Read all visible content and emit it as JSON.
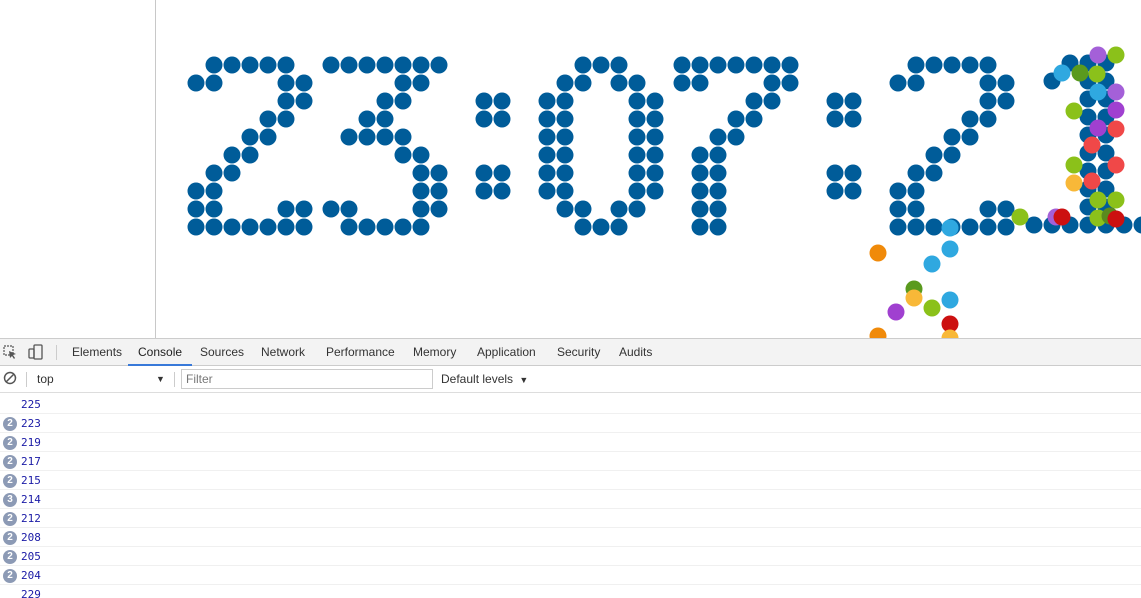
{
  "clock": {
    "time": "23:07:2",
    "color": "#005c99"
  },
  "devtools": {
    "tabs": [
      {
        "label": "Elements",
        "active": false
      },
      {
        "label": "Console",
        "active": true
      },
      {
        "label": "Sources",
        "active": false
      },
      {
        "label": "Network",
        "active": false
      },
      {
        "label": "Performance",
        "active": false
      },
      {
        "label": "Memory",
        "active": false
      },
      {
        "label": "Application",
        "active": false
      },
      {
        "label": "Security",
        "active": false
      },
      {
        "label": "Audits",
        "active": false
      }
    ],
    "accent": "#3879d9",
    "context": "top",
    "filter_placeholder": "Filter",
    "levels_label": "Default levels"
  },
  "console": {
    "messages": [
      {
        "count": null,
        "value": "225"
      },
      {
        "count": "2",
        "value": "223"
      },
      {
        "count": "2",
        "value": "219"
      },
      {
        "count": "2",
        "value": "217"
      },
      {
        "count": "2",
        "value": "215"
      },
      {
        "count": "3",
        "value": "214"
      },
      {
        "count": "2",
        "value": "212"
      },
      {
        "count": "2",
        "value": "208"
      },
      {
        "count": "2",
        "value": "205"
      },
      {
        "count": "2",
        "value": "204"
      },
      {
        "count": null,
        "value": "229"
      }
    ],
    "value_color": "#1a1aa6"
  }
}
